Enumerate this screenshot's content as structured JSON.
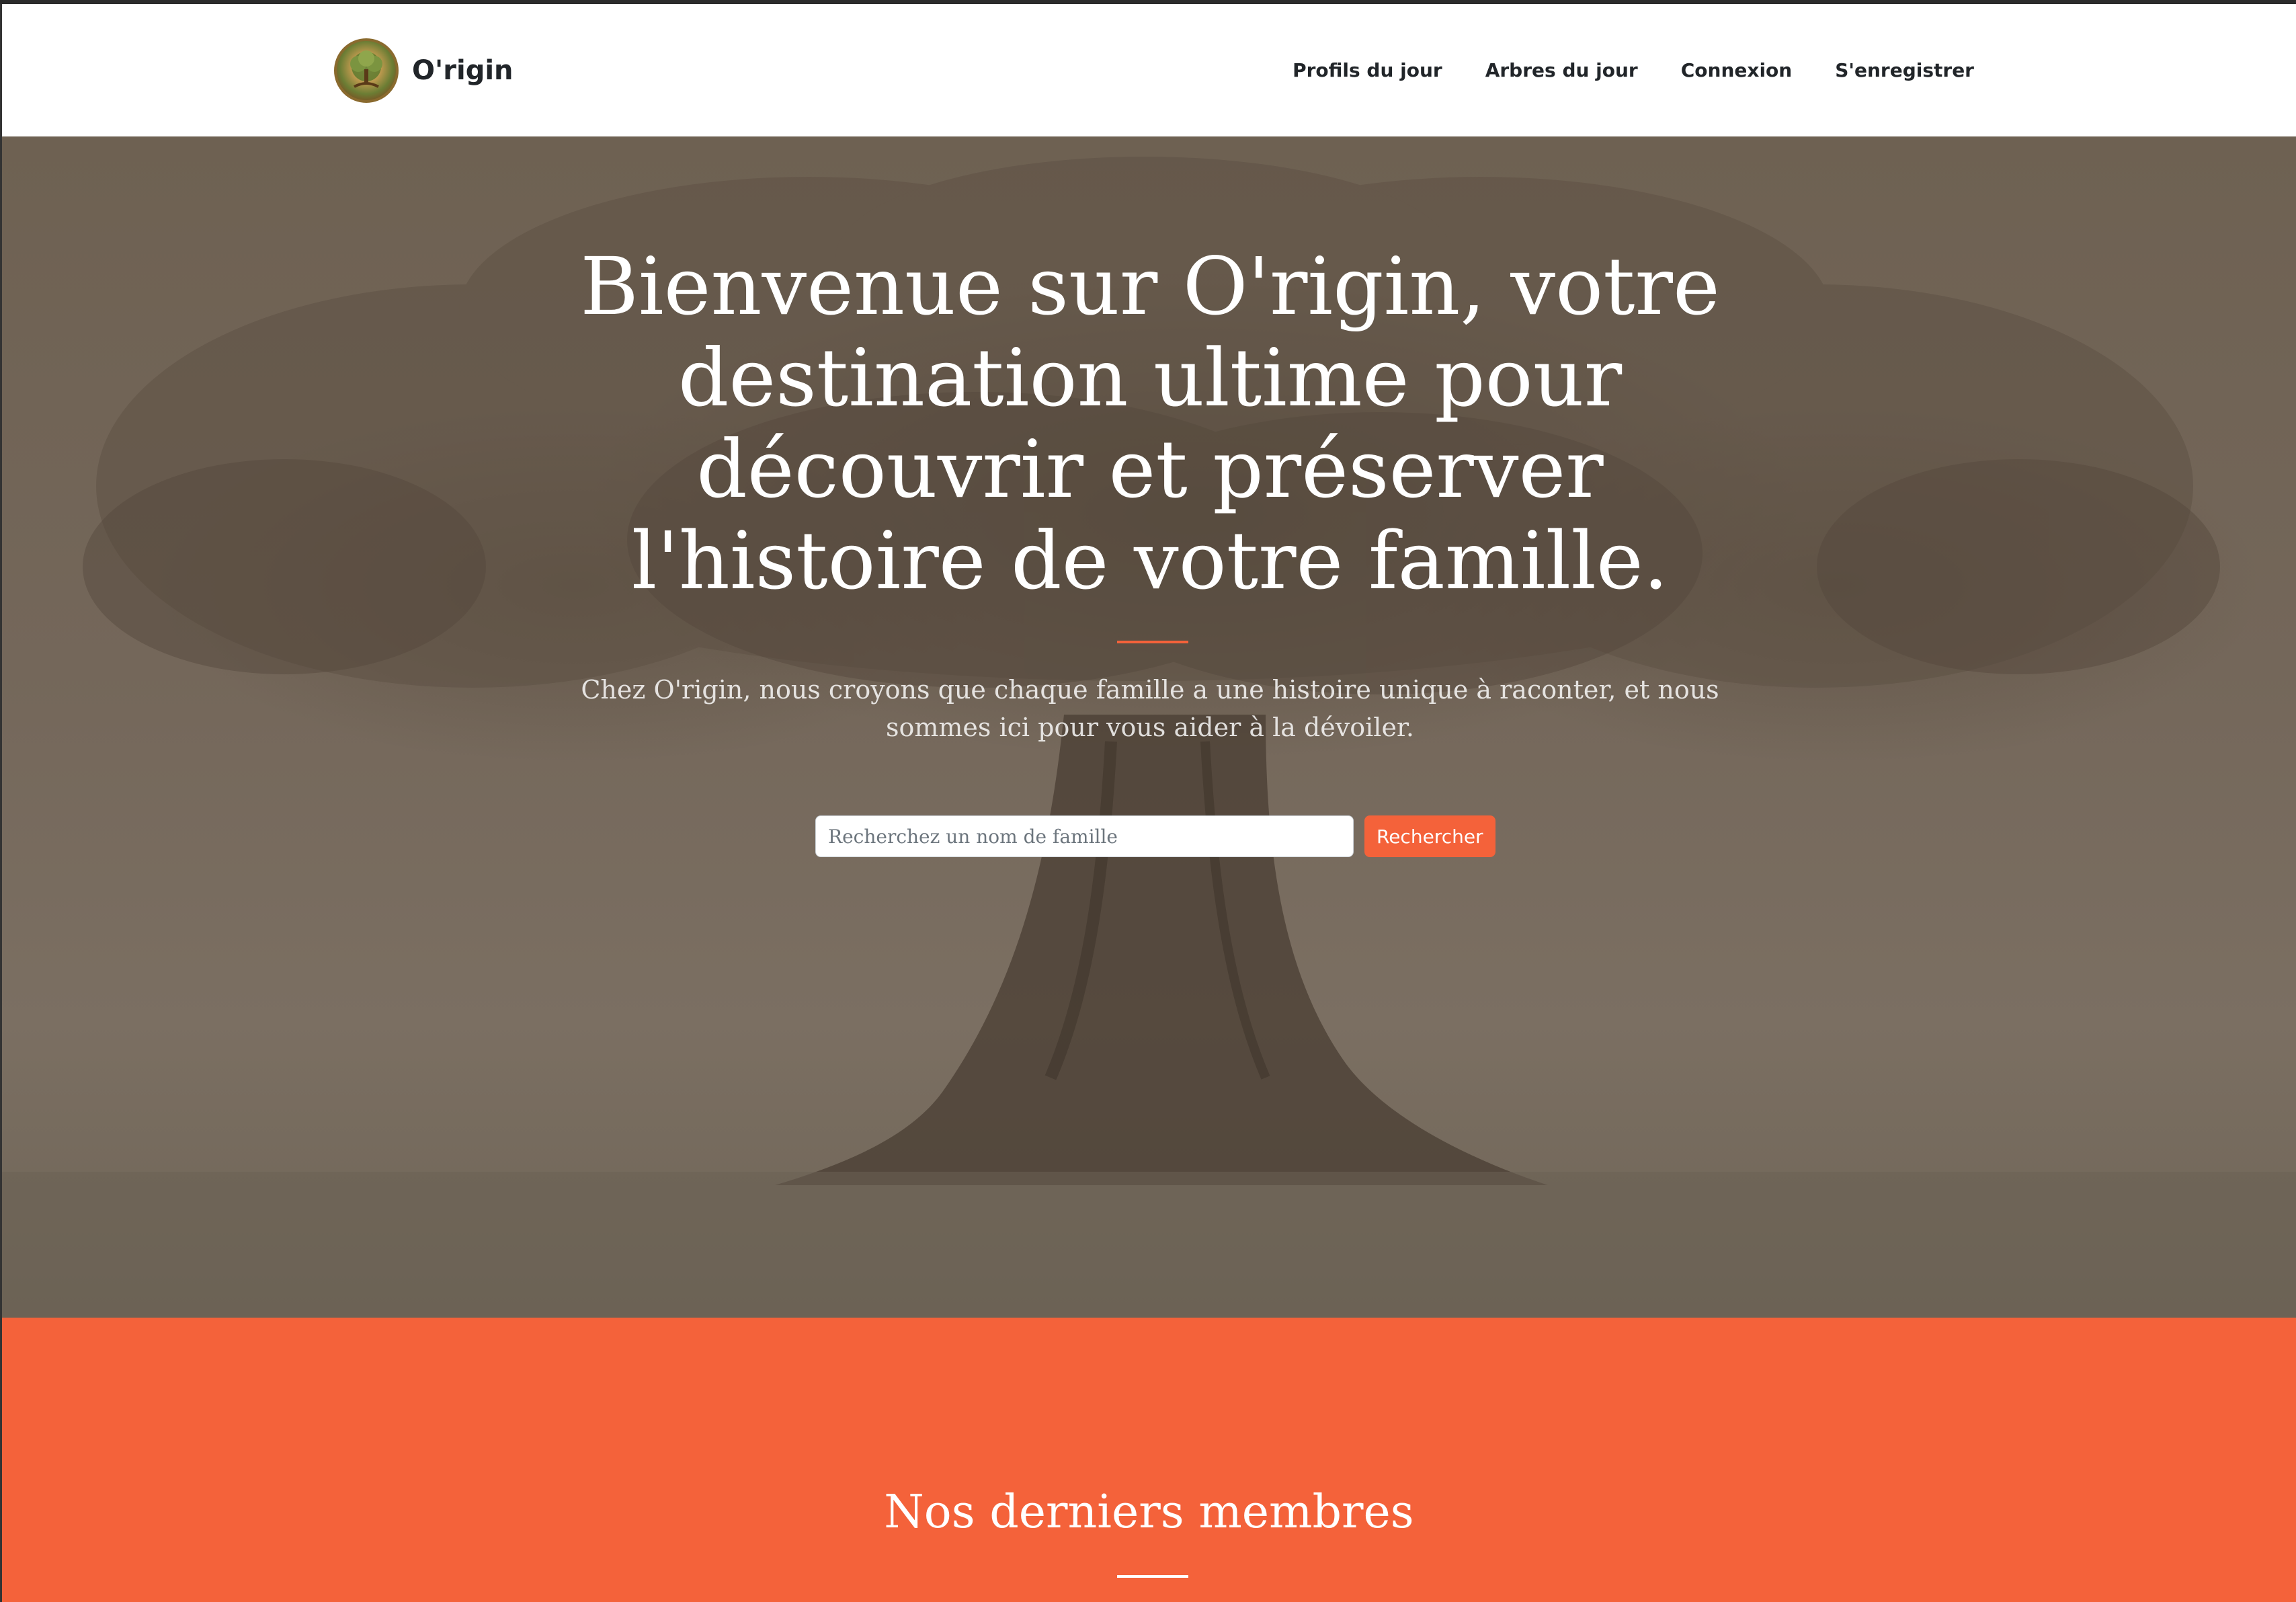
{
  "navbar": {
    "brand_name": "O'rigin",
    "brand_logo_icon": "tree-of-life-logo",
    "links": [
      {
        "label": "Profils du jour"
      },
      {
        "label": "Arbres du jour"
      },
      {
        "label": "Connexion"
      },
      {
        "label": "S'enregistrer"
      }
    ]
  },
  "hero": {
    "title_lines": [
      "Bienvenue sur O'rigin, votre",
      "destination ultime pour",
      "découvrir et préserver",
      "l'histoire de votre famille."
    ],
    "subtitle_lines": [
      "Chez O'rigin, nous croyons que chaque famille a une histoire unique à raconter, et nous",
      "sommes ici pour vous aider à la dévoiler."
    ],
    "search": {
      "placeholder": "Recherchez un nom de famille",
      "value": "",
      "button_label": "Rechercher"
    },
    "background_image": "old-tree-sepia"
  },
  "members": {
    "title": "Nos derniers membres"
  },
  "colors": {
    "primary": "#f4623a",
    "navbar_bg": "#ffffff",
    "text_dark": "#212529",
    "hero_overlay": "#74675a"
  }
}
